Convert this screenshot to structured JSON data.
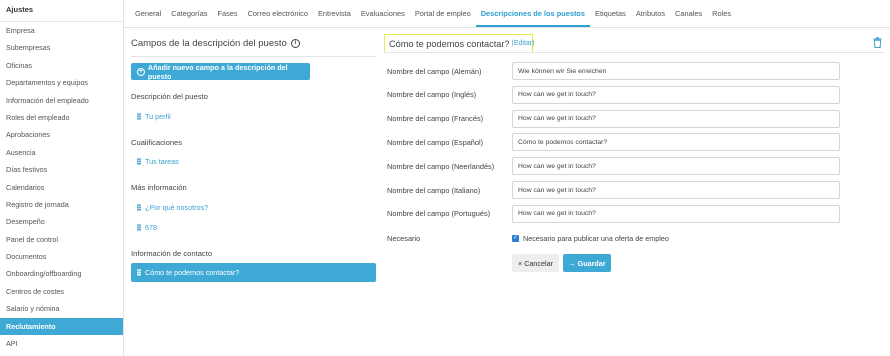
{
  "sidebar": {
    "title": "Ajustes",
    "items": [
      {
        "label": "Empresa"
      },
      {
        "label": "Subempresas"
      },
      {
        "label": "Oficinas"
      },
      {
        "label": "Departamentos y equipos"
      },
      {
        "label": "Información del empleado"
      },
      {
        "label": "Roles del empleado"
      },
      {
        "label": "Aprobaciones"
      },
      {
        "label": "Ausencia"
      },
      {
        "label": "Días festivos"
      },
      {
        "label": "Calendarios"
      },
      {
        "label": "Registro de jornada"
      },
      {
        "label": "Desempeño"
      },
      {
        "label": "Panel de control"
      },
      {
        "label": "Documentos"
      },
      {
        "label": "Onboarding/offboarding"
      },
      {
        "label": "Centros de costes"
      },
      {
        "label": "Salario y nómina"
      },
      {
        "label": "Reclutamiento"
      },
      {
        "label": "API"
      }
    ],
    "active_index": 17
  },
  "tabs": [
    {
      "label": "General"
    },
    {
      "label": "Categorías"
    },
    {
      "label": "Fases"
    },
    {
      "label": "Correo electrónico"
    },
    {
      "label": "Entrevista"
    },
    {
      "label": "Evaluaciones"
    },
    {
      "label": "Portal de empleo"
    },
    {
      "label": "Descripciones de los puestos"
    },
    {
      "label": "Etiquetas"
    },
    {
      "label": "Atributos"
    },
    {
      "label": "Canales"
    },
    {
      "label": "Roles"
    }
  ],
  "left_panel": {
    "title": "Campos de la descripción del puesto",
    "info_symbol": "i",
    "add_button": "Añadir nuevo campo a la descripción del puesto",
    "sections": [
      {
        "heading": "Descripción del puesto",
        "fields": [
          "Tu perfil"
        ]
      },
      {
        "heading": "Cualificaciones",
        "fields": [
          "Tus tareas"
        ]
      },
      {
        "heading": "Más información",
        "fields": [
          "¿Por qué nosotros?",
          "678"
        ]
      },
      {
        "heading": "Información de contacto",
        "fields": [
          "Cómo te podemos contactar?"
        ]
      }
    ]
  },
  "right_panel": {
    "title": "Cómo te podemos contactar?",
    "edit_link": "(Editar)",
    "fields": [
      {
        "label": "Nombre del campo (Alemán)",
        "value": "Wie können wir Sie erreichen"
      },
      {
        "label": "Nombre del campo (Inglés)",
        "value": "How can we get in touch?"
      },
      {
        "label": "Nombre del campo (Francés)",
        "value": "How can we get in touch?"
      },
      {
        "label": "Nombre del campo (Español)",
        "value": "Cómo te podemos contactar?"
      },
      {
        "label": "Nombre del campo (Neerlandés)",
        "value": "How can we get in touch?"
      },
      {
        "label": "Nombre del campo (Italiano)",
        "value": "How can we get in touch?"
      },
      {
        "label": "Nombre del campo (Portugués)",
        "value": "How can we get in touch?"
      }
    ],
    "required_label": "Necesario",
    "required_checkbox_text": "Necesario para publicar una oferta de empleo",
    "required_checked": true,
    "cancel_button": "Cancelar",
    "save_button": "Guardar"
  },
  "colors": {
    "accent": "#3fa9d6",
    "link": "#3fa0cf",
    "highlight_border": "#eee84a"
  }
}
